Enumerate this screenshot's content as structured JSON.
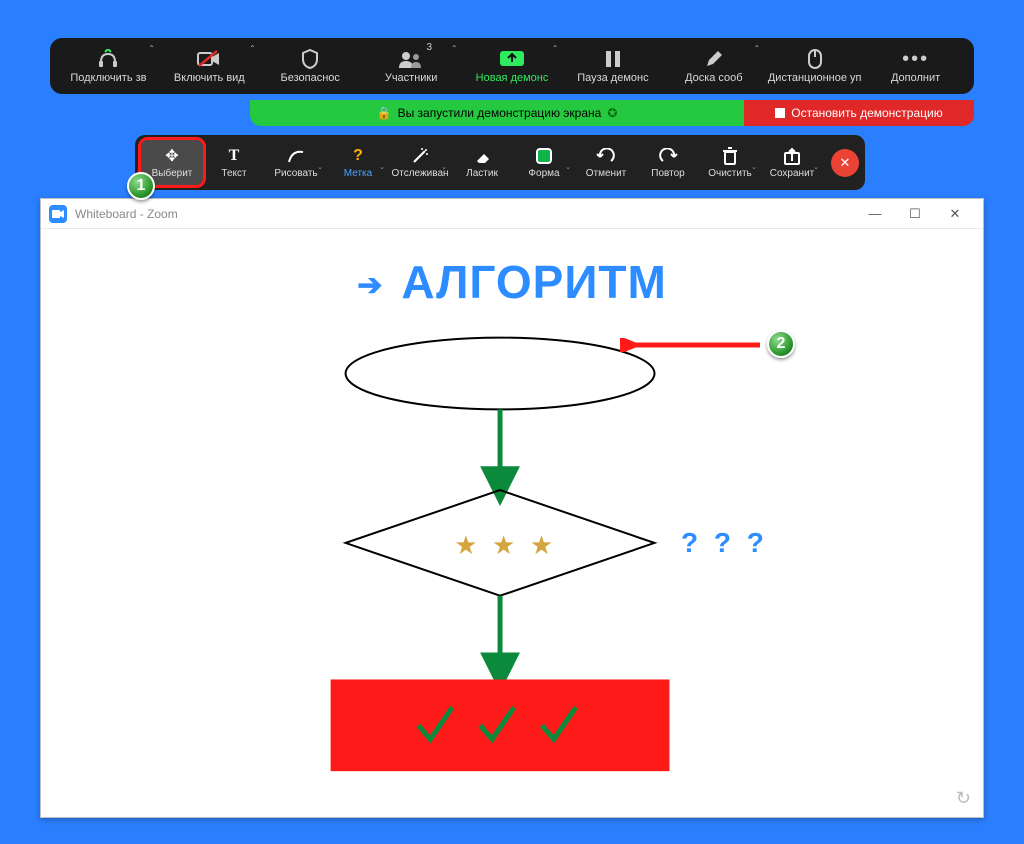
{
  "main_toolbar": {
    "audio": "Подключить зв",
    "video": "Включить вид",
    "security": "Безопаснос",
    "participants": "Участники",
    "participants_count": "3",
    "new_share": "Новая демонс",
    "pause_share": "Пауза демонс",
    "whiteboard_btn": "Доска сооб",
    "remote_control": "Дистанционное уп",
    "more": "Дополнит"
  },
  "share_status": {
    "sharing_text": "Вы запустили демонстрацию экрана",
    "stop_text": "Остановить демонстрацию"
  },
  "anno_toolbar": {
    "select": "Выберит",
    "text": "Текст",
    "draw": "Рисовать",
    "marker": "Метка",
    "spotlight": "Отслеживан",
    "eraser": "Ластик",
    "format": "Форма",
    "undo": "Отменит",
    "redo": "Повтор",
    "clear": "Очистить",
    "save": "Сохранит"
  },
  "badges": {
    "b1": "1",
    "b2": "2"
  },
  "whiteboard": {
    "window_title": "Whiteboard - Zoom",
    "heading": "АЛГОРИТМ",
    "question_marks": "? ? ?"
  }
}
